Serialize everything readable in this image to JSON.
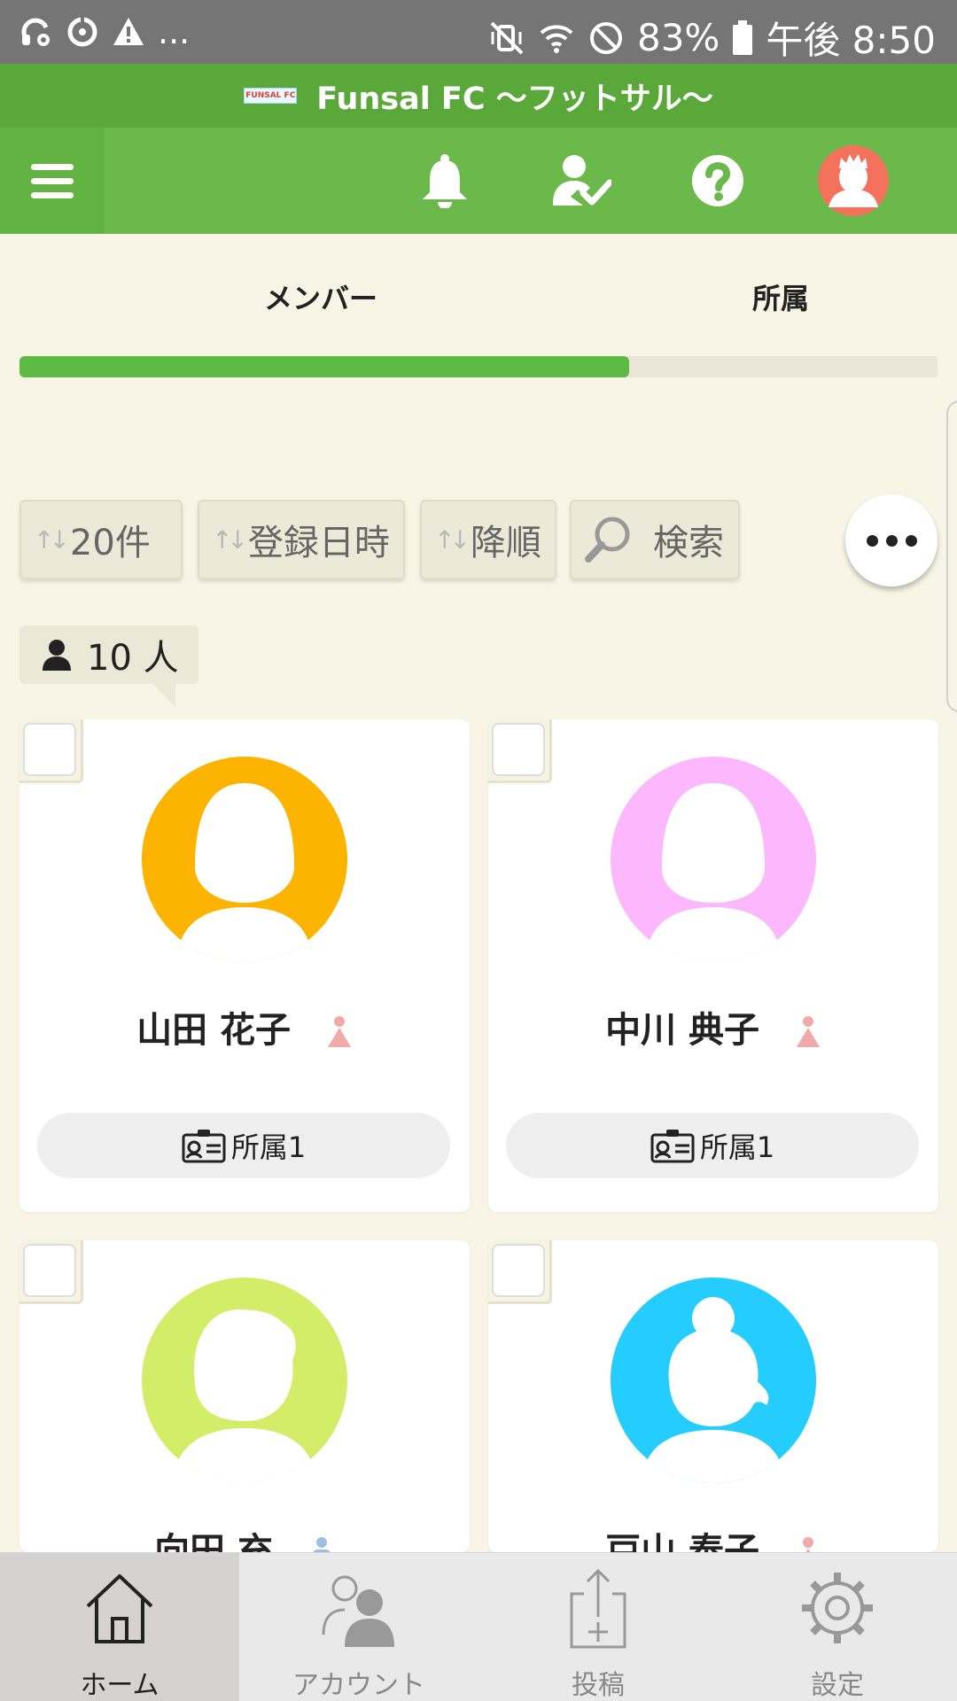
{
  "status_bar": {
    "left_more": "...",
    "battery": "83%",
    "time": "午後 8:50"
  },
  "app": {
    "logo_text": "FUNSAL FC",
    "title": "Funsal FC 〜フットサル〜"
  },
  "tabs": [
    {
      "label": "メンバー",
      "active": true
    },
    {
      "label": "所属",
      "active": false
    }
  ],
  "filters": {
    "count_label": "20件",
    "sort_field_label": "登録日時",
    "order_label": "降順",
    "search_label": "検索"
  },
  "member_count": "10 人",
  "members": [
    {
      "name": "山田 花子",
      "affiliation": "所属1",
      "avatar_color": "#fcb400",
      "gender": "female"
    },
    {
      "name": "中川 典子",
      "affiliation": "所属1",
      "avatar_color": "#fdb7fd",
      "gender": "female"
    },
    {
      "name": "向田 充",
      "affiliation": "",
      "avatar_color": "#d4ed68",
      "gender": "male"
    },
    {
      "name": "戸山 泰子",
      "affiliation": "",
      "avatar_color": "#24cdfd",
      "gender": "female"
    }
  ],
  "colors": {
    "header_green": "#6ab94a",
    "title_green": "#5aa83a",
    "female": "#f2a9a9",
    "male": "#9dc0e2",
    "profile_avatar": "#f4725c"
  },
  "bottom_nav": [
    {
      "label": "ホーム",
      "icon": "home-icon",
      "active": true
    },
    {
      "label": "アカウント",
      "icon": "account-icon",
      "active": false
    },
    {
      "label": "投稿",
      "icon": "post-icon",
      "active": false
    },
    {
      "label": "設定",
      "icon": "settings-icon",
      "active": false
    }
  ]
}
